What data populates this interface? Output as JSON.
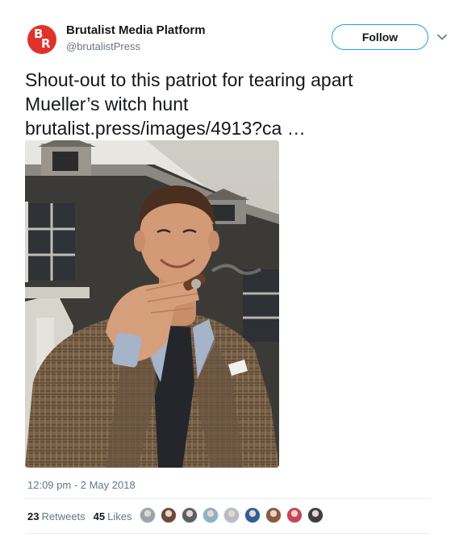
{
  "account": {
    "display_name": "Brutalist Media Platform",
    "handle": "@brutalistPress",
    "avatar_letters": [
      "B",
      "R"
    ],
    "avatar_color": "#e0322a"
  },
  "follow_label": "Follow",
  "tweet": {
    "text_line1": "Shout-out to this patriot for tearing apart",
    "text_line2": "Mueller’s witch hunt",
    "link": "brutalist.press/images/4913?ca",
    "ellipsis": "…"
  },
  "timestamp": "12:09 pm - 2 May 2018",
  "stats": {
    "retweets_count": "23",
    "retweets_label": "Retweets",
    "likes_count": "45",
    "likes_label": "Likes"
  },
  "liker_colors": [
    "#9aa4ad",
    "#6b4a3a",
    "#5a6068",
    "#8fb0c8",
    "#b7bcc4",
    "#2f5f9a",
    "#8a5a3c",
    "#c7445a",
    "#3a3f45"
  ],
  "colors": {
    "accent": "#1da1f2",
    "secondary_text": "#657786"
  }
}
